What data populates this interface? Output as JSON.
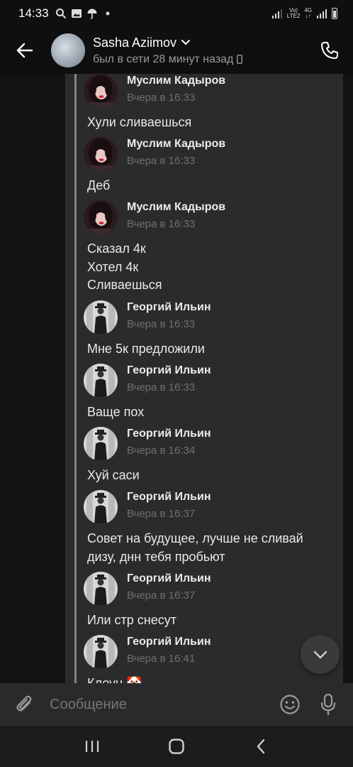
{
  "statusbar": {
    "time": "14:33",
    "network_line1": "Vo)",
    "network_line2": "LTE2",
    "net_type": "4G"
  },
  "header": {
    "name": "Sasha Aziimov",
    "status": "был в сети 28 минут назад"
  },
  "messages": [
    {
      "author": "Муслим Кадыров",
      "time": "Вчера в 16:33",
      "lines": [
        "Хули сливаешься"
      ],
      "avatar": "girl"
    },
    {
      "author": "Муслим Кадыров",
      "time": "Вчера в 16:33",
      "lines": [
        "Деб"
      ],
      "avatar": "girl"
    },
    {
      "author": "Муслим Кадыров",
      "time": "Вчера в 16:33",
      "lines": [
        "Сказал 4к",
        "Хотел 4к",
        "Сливаешься"
      ],
      "avatar": "girl"
    },
    {
      "author": "Георгий Ильин",
      "time": "Вчера в 16:33",
      "lines": [
        "Мне 5к предложили"
      ],
      "avatar": "man"
    },
    {
      "author": "Георгий Ильин",
      "time": "Вчера в 16:33",
      "lines": [
        "Ваще пох"
      ],
      "avatar": "man"
    },
    {
      "author": "Георгий Ильин",
      "time": "Вчера в 16:34",
      "lines": [
        "Хуй саси"
      ],
      "avatar": "man"
    },
    {
      "author": "Георгий Ильин",
      "time": "Вчера в 16:37",
      "lines": [
        "Совет на будущее, лучше не сливай",
        "дизу, днн тебя пробьют"
      ],
      "avatar": "man"
    },
    {
      "author": "Георгий Ильин",
      "time": "Вчера в 16:37",
      "lines": [
        "Или стр снесут"
      ],
      "avatar": "man"
    },
    {
      "author": "Георгий Ильин",
      "time": "Вчера в 16:41",
      "lines": [
        "Клоун 🤡"
      ],
      "avatar": "man"
    }
  ],
  "composer": {
    "placeholder": "Сообщение"
  },
  "icons": {
    "back": "arrow-left-icon",
    "phone": "phone-icon",
    "attach": "paperclip-icon",
    "emoji": "smiley-icon",
    "mic": "microphone-icon",
    "scroll": "chevron-down-icon"
  },
  "colors": {
    "background": "#121212",
    "card": "#2b2b2d",
    "text": "#e9e9e9",
    "muted": "#6f6f72"
  }
}
